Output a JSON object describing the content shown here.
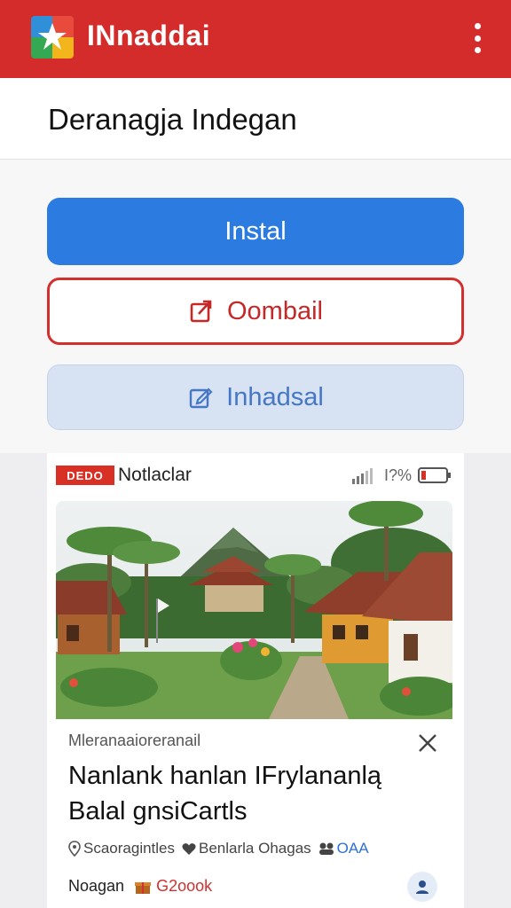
{
  "app": {
    "title": "INnaddai",
    "logo_icon": "star-logo-icon",
    "menu_icon": "kebab-menu-icon"
  },
  "header": {
    "title": "Deranagja Indegan"
  },
  "buttons": {
    "install_label": "Instal",
    "download_label": "Oombail",
    "download_icon": "share-square-icon",
    "secondary_label": "Inhadsal",
    "secondary_icon": "edit-square-icon"
  },
  "card": {
    "status_tag": "DEDO",
    "status_name": "Notlaclar",
    "battery_text": "I?%",
    "photo_icon": "village-photo",
    "meta_label": "Mleranaaioreranail",
    "headline": "Nanlank hanlan IFrylananlą Balal gnsiCartls",
    "tags": [
      {
        "icon": "location-pin-icon",
        "label": "Scaoragintles"
      },
      {
        "icon": "heart-icon",
        "label": "Benlarla  Ohagas"
      },
      {
        "icon": "group-icon",
        "label": "OAA"
      }
    ],
    "footer_label": "Noagan",
    "footer_highlight": "G2oook",
    "footer_icon": "gift-box-icon",
    "profile_icon": "person-icon"
  },
  "colors": {
    "brand_red": "#d42b2b",
    "install_blue": "#2c7be0",
    "outline_red": "#d32f2f",
    "secondary_bg": "#d7e2f3"
  }
}
